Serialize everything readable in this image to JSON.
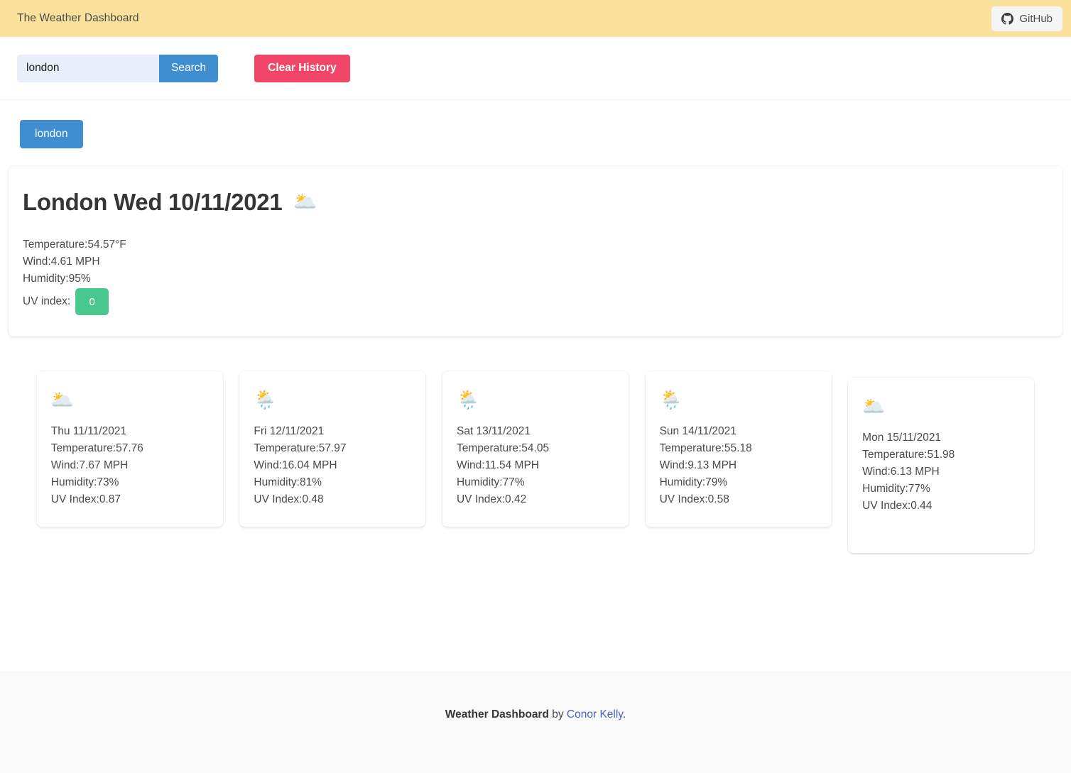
{
  "navbar": {
    "title": "The Weather Dashboard",
    "github_label": "GitHub",
    "background": "#fae19c"
  },
  "search": {
    "value": "london",
    "placeholder": "",
    "search_label": "Search",
    "clear_label": "Clear History",
    "search_color": "#3e8ed0",
    "clear_color": "#f14668"
  },
  "history": {
    "items": [
      {
        "label": "london"
      }
    ]
  },
  "current": {
    "title": "London Wed 10/11/2021",
    "icon": "cloud-behind-cloud-icon",
    "icon_glyph": "🌥️",
    "temperature": "Temperature:54.57°F",
    "wind": "Wind:4.61 MPH",
    "humidity": "Humidity:95%",
    "uv_label": "UV index:",
    "uv_value": "0",
    "uv_color": "#48c78e"
  },
  "forecast": [
    {
      "icon": "cloud-behind-cloud-icon",
      "icon_glyph": "🌥️",
      "date": "Thu 11/11/2021",
      "temperature": "Temperature:57.76",
      "wind": "Wind:7.67 MPH",
      "humidity": "Humidity:73%",
      "uv": "UV Index:0.87"
    },
    {
      "icon": "sun-behind-rain-cloud-icon",
      "icon_glyph": "🌦️",
      "date": "Fri 12/11/2021",
      "temperature": "Temperature:57.97",
      "wind": "Wind:16.04 MPH",
      "humidity": "Humidity:81%",
      "uv": "UV Index:0.48"
    },
    {
      "icon": "sun-behind-rain-cloud-icon",
      "icon_glyph": "🌦️",
      "date": "Sat 13/11/2021",
      "temperature": "Temperature:54.05",
      "wind": "Wind:11.54 MPH",
      "humidity": "Humidity:77%",
      "uv": "UV Index:0.42"
    },
    {
      "icon": "sun-behind-rain-cloud-icon",
      "icon_glyph": "🌦️",
      "date": "Sun 14/11/2021",
      "temperature": "Temperature:55.18",
      "wind": "Wind:9.13 MPH",
      "humidity": "Humidity:79%",
      "uv": "UV Index:0.58"
    },
    {
      "icon": "cloud-behind-cloud-icon",
      "icon_glyph": "🌥️",
      "date": "Mon 15/11/2021",
      "temperature": "Temperature:51.98",
      "wind": "Wind:6.13 MPH",
      "humidity": "Humidity:77%",
      "uv": "UV Index:0.44"
    }
  ],
  "footer": {
    "app_name": "Weather Dashboard",
    "by": " by ",
    "author": "Conor Kelly",
    "period": ".",
    "link_color": "#485fc7"
  }
}
